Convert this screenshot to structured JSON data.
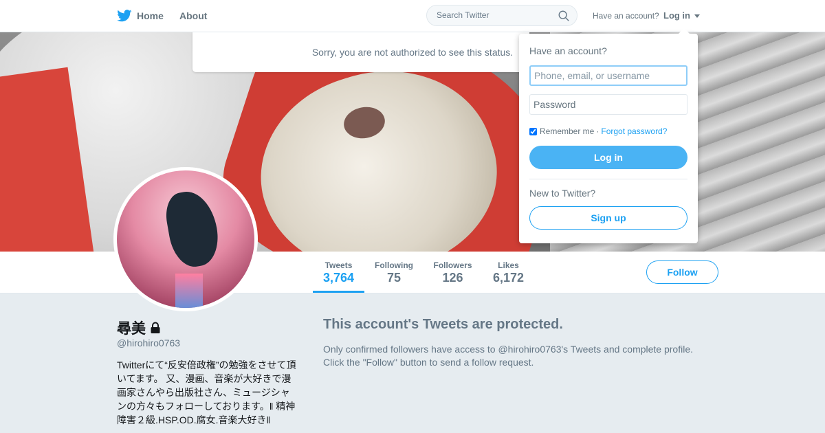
{
  "topbar": {
    "home_label": "Home",
    "about_label": "About",
    "search_placeholder": "Search Twitter",
    "have_account_text": "Have an account?",
    "login_label": "Log in",
    "brand_color": "#1da1f2"
  },
  "status_message": "Sorry, you are not authorized to see this status.",
  "login_dropdown": {
    "title": "Have an account?",
    "username_placeholder": "Phone, email, or username",
    "password_placeholder": "Password",
    "remember_label": "Remember me",
    "separator": "·",
    "forgot_label": "Forgot password?",
    "login_button": "Log in",
    "new_text": "New to Twitter?",
    "signup_button": "Sign up"
  },
  "stats": [
    {
      "label": "Tweets",
      "value": "3,764"
    },
    {
      "label": "Following",
      "value": "75"
    },
    {
      "label": "Followers",
      "value": "126"
    },
    {
      "label": "Likes",
      "value": "6,172"
    }
  ],
  "follow_button": "Follow",
  "profile": {
    "name": "尋美",
    "handle": "@hirohiro0763",
    "bio": "Twitterにて“反安倍政権”の勉強をさせて頂いてます。 又、漫画、音楽が大好きで漫画家さんやら出版社さん、ミュージシャンの方々もフォローしております。‖ 精神障害２級.HSP.OD.腐女.音楽大好き‖"
  },
  "protected": {
    "title": "This account's Tweets are protected.",
    "line1": "Only confirmed followers have access to @hirohiro0763's Tweets and complete profile.",
    "line2": "Click the \"Follow\" button to send a follow request."
  }
}
